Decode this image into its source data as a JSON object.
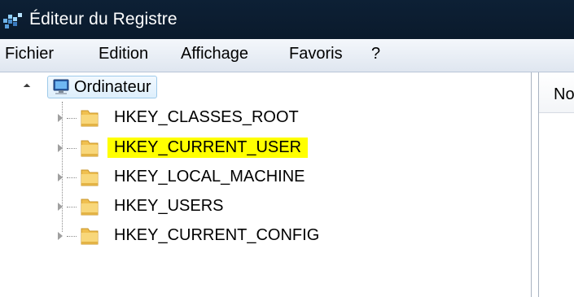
{
  "window": {
    "title": "Éditeur du Registre"
  },
  "menubar": {
    "items": [
      {
        "label": "Fichier"
      },
      {
        "label": "Edition"
      },
      {
        "label": "Affichage"
      },
      {
        "label": "Favoris"
      },
      {
        "label": "?"
      }
    ]
  },
  "tree": {
    "root": {
      "label": "Ordinateur",
      "expanded": true,
      "icon": "computer-icon"
    },
    "keys": [
      {
        "label": "HKEY_CLASSES_ROOT",
        "icon": "folder-icon",
        "highlighted": false
      },
      {
        "label": "HKEY_CURRENT_USER",
        "icon": "folder-icon",
        "highlighted": true,
        "highlight_color": "#ffff00"
      },
      {
        "label": "HKEY_LOCAL_MACHINE",
        "icon": "folder-icon",
        "highlighted": false
      },
      {
        "label": "HKEY_USERS",
        "icon": "folder-icon",
        "highlighted": false
      },
      {
        "label": "HKEY_CURRENT_CONFIG",
        "icon": "folder-icon",
        "highlighted": false
      }
    ]
  },
  "right_pane": {
    "column_header": "No"
  },
  "colors": {
    "titlebar": "#0d2035",
    "highlight": "#ffff00",
    "selection_border": "#9ecaea"
  }
}
